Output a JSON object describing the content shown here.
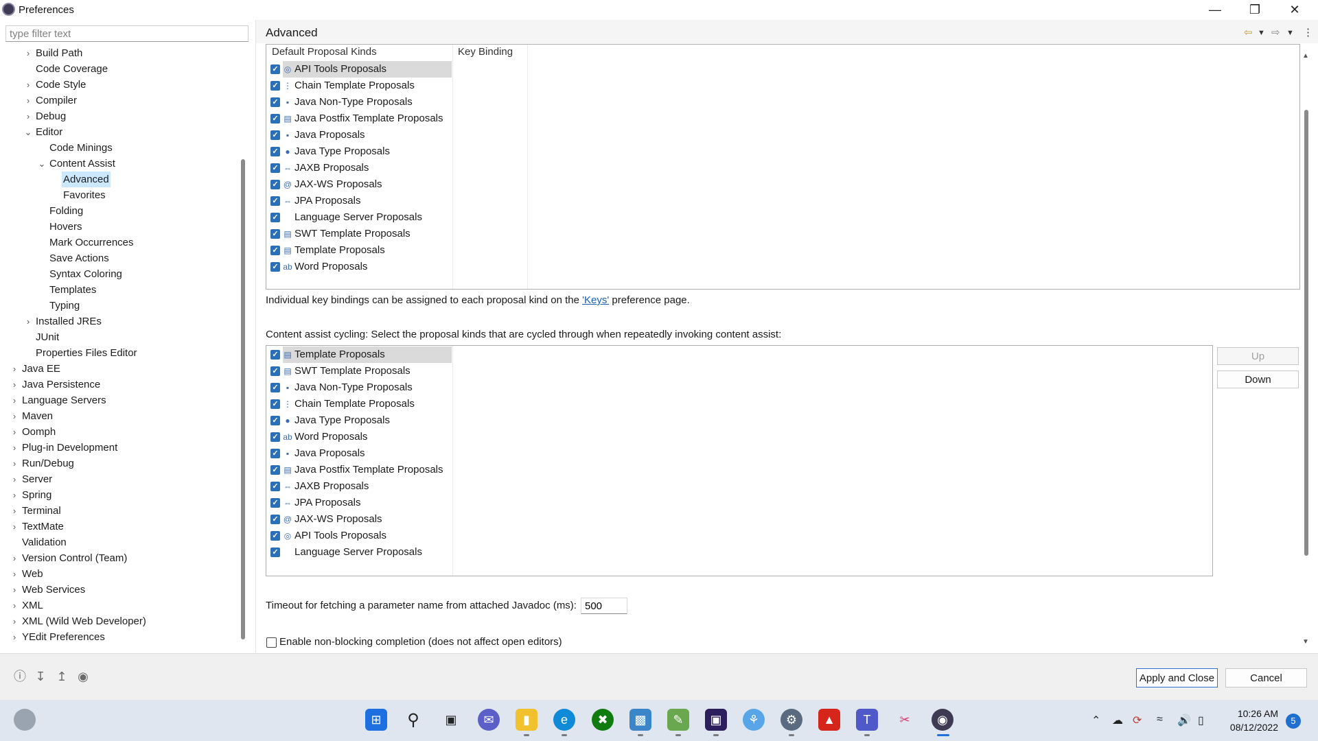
{
  "window": {
    "title": "Preferences",
    "controls": [
      "minimize",
      "restore",
      "close"
    ]
  },
  "filter": {
    "placeholder": "type filter text"
  },
  "tree": [
    {
      "label": "Build Path",
      "level": 1,
      "arrow": "›"
    },
    {
      "label": "Code Coverage",
      "level": 1,
      "arrow": ""
    },
    {
      "label": "Code Style",
      "level": 1,
      "arrow": "›"
    },
    {
      "label": "Compiler",
      "level": 1,
      "arrow": "›"
    },
    {
      "label": "Debug",
      "level": 1,
      "arrow": "›"
    },
    {
      "label": "Editor",
      "level": 1,
      "arrow": "⌄"
    },
    {
      "label": "Code Minings",
      "level": 2,
      "arrow": ""
    },
    {
      "label": "Content Assist",
      "level": 2,
      "arrow": "⌄"
    },
    {
      "label": "Advanced",
      "level": 3,
      "arrow": "",
      "selected": true
    },
    {
      "label": "Favorites",
      "level": 3,
      "arrow": ""
    },
    {
      "label": "Folding",
      "level": 2,
      "arrow": ""
    },
    {
      "label": "Hovers",
      "level": 2,
      "arrow": ""
    },
    {
      "label": "Mark Occurrences",
      "level": 2,
      "arrow": ""
    },
    {
      "label": "Save Actions",
      "level": 2,
      "arrow": ""
    },
    {
      "label": "Syntax Coloring",
      "level": 2,
      "arrow": ""
    },
    {
      "label": "Templates",
      "level": 2,
      "arrow": ""
    },
    {
      "label": "Typing",
      "level": 2,
      "arrow": ""
    },
    {
      "label": "Installed JREs",
      "level": 1,
      "arrow": "›"
    },
    {
      "label": "JUnit",
      "level": 1,
      "arrow": ""
    },
    {
      "label": "Properties Files Editor",
      "level": 1,
      "arrow": ""
    },
    {
      "label": "Java EE",
      "level": 0,
      "arrow": "›"
    },
    {
      "label": "Java Persistence",
      "level": 0,
      "arrow": "›"
    },
    {
      "label": "Language Servers",
      "level": 0,
      "arrow": "›"
    },
    {
      "label": "Maven",
      "level": 0,
      "arrow": "›"
    },
    {
      "label": "Oomph",
      "level": 0,
      "arrow": "›"
    },
    {
      "label": "Plug-in Development",
      "level": 0,
      "arrow": "›"
    },
    {
      "label": "Run/Debug",
      "level": 0,
      "arrow": "›"
    },
    {
      "label": "Server",
      "level": 0,
      "arrow": "›"
    },
    {
      "label": "Spring",
      "level": 0,
      "arrow": "›"
    },
    {
      "label": "Terminal",
      "level": 0,
      "arrow": "›"
    },
    {
      "label": "TextMate",
      "level": 0,
      "arrow": "›"
    },
    {
      "label": "Validation",
      "level": 0,
      "arrow": ""
    },
    {
      "label": "Version Control (Team)",
      "level": 0,
      "arrow": "›"
    },
    {
      "label": "Web",
      "level": 0,
      "arrow": "›"
    },
    {
      "label": "Web Services",
      "level": 0,
      "arrow": "›"
    },
    {
      "label": "XML",
      "level": 0,
      "arrow": "›"
    },
    {
      "label": "XML (Wild Web Developer)",
      "level": 0,
      "arrow": "›"
    },
    {
      "label": "YEdit Preferences",
      "level": 0,
      "arrow": "›"
    }
  ],
  "page": {
    "title": "Advanced"
  },
  "default_table": {
    "col1_header": "Default Proposal Kinds",
    "col2_header": "Key Binding",
    "rows": [
      {
        "label": "API Tools Proposals",
        "icon": "api-tools-icon",
        "glyph": "◎",
        "checked": true,
        "selected": true
      },
      {
        "label": "Chain Template Proposals",
        "icon": "chain-template-icon",
        "glyph": "⋮",
        "checked": true
      },
      {
        "label": "Java Non-Type Proposals",
        "icon": "java-non-type-icon",
        "glyph": "▪",
        "checked": true
      },
      {
        "label": "Java Postfix Template Proposals",
        "icon": "postfix-template-icon",
        "glyph": "▤",
        "checked": true
      },
      {
        "label": "Java Proposals",
        "icon": "java-proposals-icon",
        "glyph": "▪",
        "checked": true
      },
      {
        "label": "Java Type Proposals",
        "icon": "java-type-icon",
        "glyph": "●",
        "checked": true
      },
      {
        "label": "JAXB Proposals",
        "icon": "jaxb-icon",
        "glyph": "⇔",
        "checked": true
      },
      {
        "label": "JAX-WS Proposals",
        "icon": "jax-ws-icon",
        "glyph": "@",
        "checked": true
      },
      {
        "label": "JPA Proposals",
        "icon": "jpa-icon",
        "glyph": "⇔",
        "checked": true
      },
      {
        "label": "Language Server Proposals",
        "icon": "",
        "glyph": "",
        "checked": true
      },
      {
        "label": "SWT Template Proposals",
        "icon": "swt-template-icon",
        "glyph": "▤",
        "checked": true
      },
      {
        "label": "Template Proposals",
        "icon": "template-icon",
        "glyph": "▤",
        "checked": true
      },
      {
        "label": "Word Proposals",
        "icon": "word-icon",
        "glyph": "ab",
        "checked": true
      }
    ]
  },
  "keys_note": {
    "prefix": "Individual key bindings can be assigned to each proposal kind on the ",
    "link": "'Keys'",
    "suffix": " preference page."
  },
  "cycling_label": "Content assist cycling: Select the proposal kinds that are cycled through when repeatedly invoking content assist:",
  "cycling_table": {
    "rows": [
      {
        "label": "Template Proposals",
        "icon": "template-icon",
        "glyph": "▤",
        "checked": true,
        "selected": true
      },
      {
        "label": "SWT Template Proposals",
        "icon": "swt-template-icon",
        "glyph": "▤",
        "checked": true
      },
      {
        "label": "Java Non-Type Proposals",
        "icon": "java-non-type-icon",
        "glyph": "▪",
        "checked": true
      },
      {
        "label": "Chain Template Proposals",
        "icon": "chain-template-icon",
        "glyph": "⋮",
        "checked": true
      },
      {
        "label": "Java Type Proposals",
        "icon": "java-type-icon",
        "glyph": "●",
        "checked": true
      },
      {
        "label": "Word Proposals",
        "icon": "word-icon",
        "glyph": "ab",
        "checked": true
      },
      {
        "label": "Java Proposals",
        "icon": "java-proposals-icon",
        "glyph": "▪",
        "checked": true
      },
      {
        "label": "Java Postfix Template Proposals",
        "icon": "postfix-template-icon",
        "glyph": "▤",
        "checked": true
      },
      {
        "label": "JAXB Proposals",
        "icon": "jaxb-icon",
        "glyph": "⇔",
        "checked": true
      },
      {
        "label": "JPA Proposals",
        "icon": "jpa-icon",
        "glyph": "⇔",
        "checked": true
      },
      {
        "label": "JAX-WS Proposals",
        "icon": "jax-ws-icon",
        "glyph": "@",
        "checked": true
      },
      {
        "label": "API Tools Proposals",
        "icon": "api-tools-icon",
        "glyph": "◎",
        "checked": true
      },
      {
        "label": "Language Server Proposals",
        "icon": "",
        "glyph": "",
        "checked": true
      }
    ],
    "up_label": "Up",
    "down_label": "Down"
  },
  "timeout": {
    "label": "Timeout for fetching a parameter name from attached Javadoc (ms):",
    "value": "500"
  },
  "nonblocking": {
    "label": "Enable non-blocking completion (does not affect open editors)",
    "checked": false
  },
  "buttons": {
    "apply_close": "Apply and Close",
    "cancel": "Cancel"
  },
  "bottom_icons": [
    "help-icon",
    "import-icon",
    "export-icon",
    "oomph-icon"
  ],
  "taskbar": {
    "apps": [
      "start-icon",
      "search-icon",
      "task-view-icon",
      "chat-icon",
      "file-explorer-icon",
      "edge-icon",
      "xbox-icon",
      "app-icon",
      "app-icon-2",
      "app-icon-3",
      "app-icon-4",
      "settings-icon",
      "acrobat-icon",
      "teams-icon",
      "snipping-icon",
      "eclipse-icon"
    ],
    "time": "10:26 AM",
    "date": "08/12/2022",
    "notifications": "5"
  },
  "colors": {
    "checkbox": "#2b6fb8",
    "tree_selection": "#cce8ff",
    "link": "#1a5fb4",
    "taskbar": "#dfe6f0"
  }
}
